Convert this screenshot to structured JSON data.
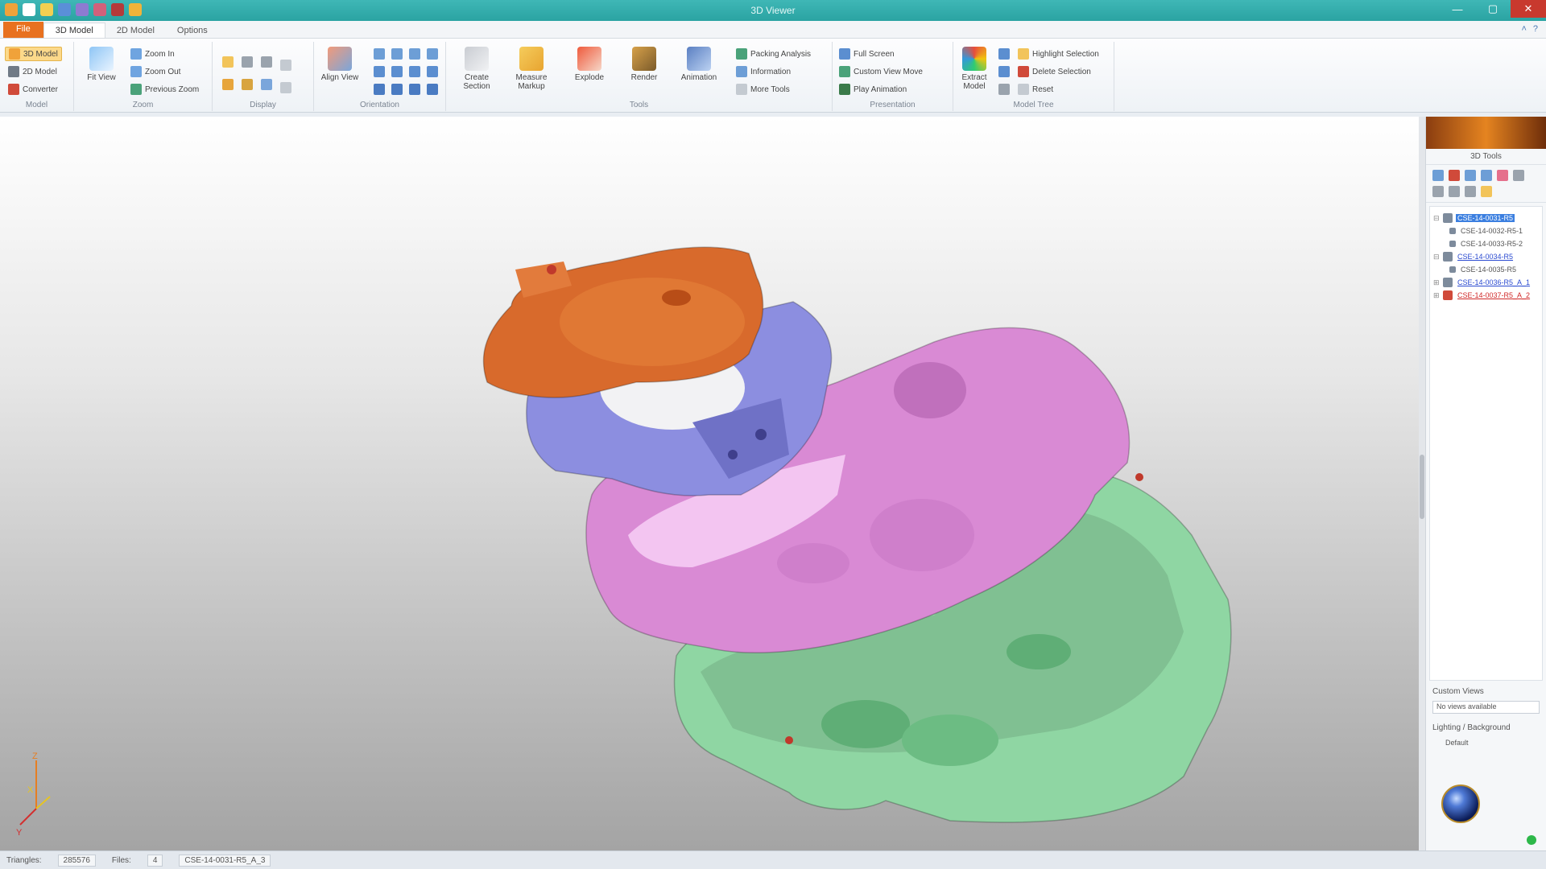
{
  "window": {
    "title": "3D Viewer"
  },
  "ribbon_tabs": [
    {
      "label": "File"
    },
    {
      "label": "3D Model"
    },
    {
      "label": "2D Model"
    },
    {
      "label": "Options"
    }
  ],
  "ribbon": {
    "model": {
      "group_label": "Model",
      "items": [
        "3D Model",
        "2D Model",
        "Converter"
      ]
    },
    "zoom": {
      "group_label": "Zoom",
      "fit": "Fit View",
      "items": [
        "Zoom In",
        "Zoom Out",
        "Previous Zoom"
      ]
    },
    "display": {
      "group_label": "Display"
    },
    "orientation": {
      "group_label": "Orientation",
      "align": "Align View"
    },
    "tools": {
      "group_label": "Tools",
      "items": [
        "Create Section",
        "Measure Markup",
        "Explode",
        "Render",
        "Animation"
      ]
    },
    "tools_small": [
      "Packing Analysis",
      "Information",
      "More Tools"
    ],
    "presentation": {
      "group_label": "Presentation",
      "items": [
        "Full Screen",
        "Custom View Move",
        "Play Animation"
      ]
    },
    "model_tree": {
      "group_label": "Model Tree",
      "big": "Extract Model",
      "items": [
        "Highlight Selection",
        "Delete Selection",
        "Reset"
      ]
    }
  },
  "panel": {
    "title": "3D Tools",
    "tree": [
      {
        "label": "CSE-14-0031-R5",
        "selected": true,
        "color": "#ffffff"
      },
      {
        "label": "CSE-14-0032-R5-1",
        "selected": false,
        "color": "#555555"
      },
      {
        "label": "CSE-14-0033-R5-2",
        "selected": false,
        "color": "#555555"
      },
      {
        "label": "CSE-14-0034-R5",
        "selected": false,
        "color": "#2a4ad0"
      },
      {
        "label": "CSE-14-0035-R5",
        "selected": false,
        "color": "#555555"
      },
      {
        "label": "CSE-14-0036-R5_A_1",
        "selected": false,
        "color": "#2a4ad0"
      },
      {
        "label": "CSE-14-0037-R5_A_2",
        "selected": false,
        "color": "#d02a2a"
      }
    ],
    "custom_views_label": "Custom Views",
    "custom_views_value": "No views available",
    "lighting_label": "Lighting / Background",
    "lighting_value": "Default"
  },
  "status": {
    "triangles_label": "Triangles:",
    "triangles_value": "285576",
    "files_label": "Files:",
    "files_value": "4",
    "file_name": "CSE-14-0031-R5_A_3"
  },
  "model_colors": {
    "top_plate": "#d86a2c",
    "ring": "#8c8ee0",
    "cover": "#d98ad4",
    "housing": "#8fd6a3"
  }
}
